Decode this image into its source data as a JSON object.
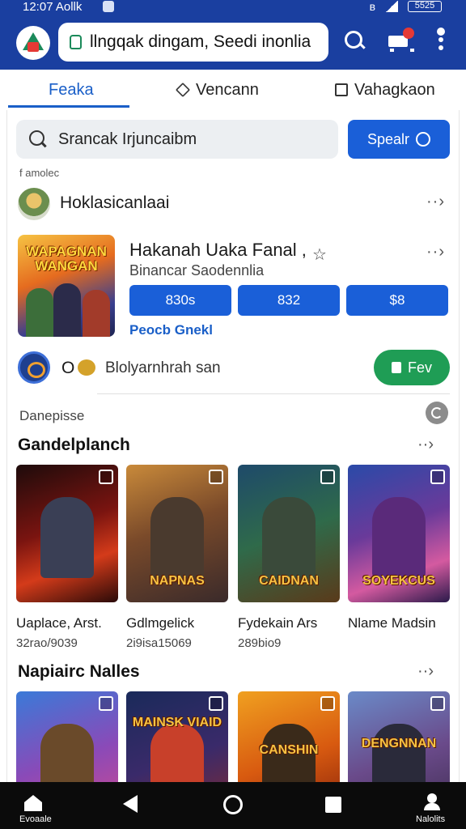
{
  "status": {
    "time": "12:07 Aollk",
    "battery": "5525"
  },
  "app_bar": {
    "search_text": "llngqak dingam, Seedi inonlia"
  },
  "tabs": [
    {
      "label": "Feaka"
    },
    {
      "label": "Vencann"
    },
    {
      "label": "Vahagkaon"
    }
  ],
  "search": {
    "placeholder": "Srancak Irjuncaibm",
    "button_label": "Spealr"
  },
  "small_label": "f amolec",
  "row1": {
    "name": "Hoklasicanlaai"
  },
  "feature": {
    "art_text": "WAPAGNAN WANGAN",
    "title": "Hakanah Uaka Fanal ,",
    "subtitle": "Binancar Saodennlia",
    "prices": [
      "830s",
      "832",
      "$8"
    ],
    "link": "Peocb Gnekl"
  },
  "row2": {
    "prefix": "O",
    "name": "Blolyarnhrah san",
    "button_label": "Fev"
  },
  "section_small": "Danepisse",
  "section1": {
    "title": "Gandelplanch",
    "games": [
      {
        "name": "Uaplace, Arst.",
        "meta": "32rao/9039",
        "art_label": "",
        "bg": "linear-gradient(160deg,#1d0b0b 0%,#7a1410 45%,#d43b1a 70%,#2a0a08 100%)",
        "hero": "#3a3f55"
      },
      {
        "name": "Gdlmgelick",
        "meta": "2i9isa15069",
        "art_label": "NAPNAS",
        "bg": "linear-gradient(160deg,#c98a3a 0%,#7a4a2a 45%,#3a2a2a 100%)",
        "hero": "#4a3a2e"
      },
      {
        "name": "Fydekain Ars",
        "meta": "289bio9",
        "art_label": "CAIDNAN",
        "bg": "linear-gradient(160deg,#1e4a6a 0%,#2f6a4a 50%,#5a3a1a 100%)",
        "hero": "#3a4a3a"
      },
      {
        "name": "Nlame Madsin",
        "meta": "",
        "art_label": "SOYEKCUS",
        "bg": "linear-gradient(160deg,#2a4aa8 0%,#6a3a9a 45%,#d45aa0 75%,#2a1a4a 100%)",
        "hero": "#5a2a7a"
      }
    ]
  },
  "section2": {
    "title": "Napiairc Nalles",
    "games": [
      {
        "art_label": "",
        "bg": "linear-gradient(160deg,#3a7ad8 0%,#8a4ab8 50%,#d84a8a 100%)",
        "hero": "#6a4a2a"
      },
      {
        "art_label": "MAINSK VIAID",
        "bg": "linear-gradient(160deg,#1a2a5a 0%,#3a2a6a 50%,#8a2a2a 100%)",
        "hero": "#c8402a"
      },
      {
        "art_label": "CANSHIN",
        "bg": "linear-gradient(160deg,#f0a020 0%,#d85a10 50%,#7a1a0a 100%)",
        "hero": "#3a2a1a"
      },
      {
        "art_label": "DENGNNAN",
        "bg": "linear-gradient(160deg,#6a8ac8 0%,#6a4a8a 50%,#3a2a4a 100%)",
        "hero": "#2a2a3a"
      }
    ]
  },
  "bottom_nav": {
    "home_label": "Evoaale",
    "profile_label": "Nalolits"
  },
  "colors": {
    "app_bar": "#1a3fa0",
    "accent": "#1a5fd8",
    "get_button": "#1f9d55"
  }
}
